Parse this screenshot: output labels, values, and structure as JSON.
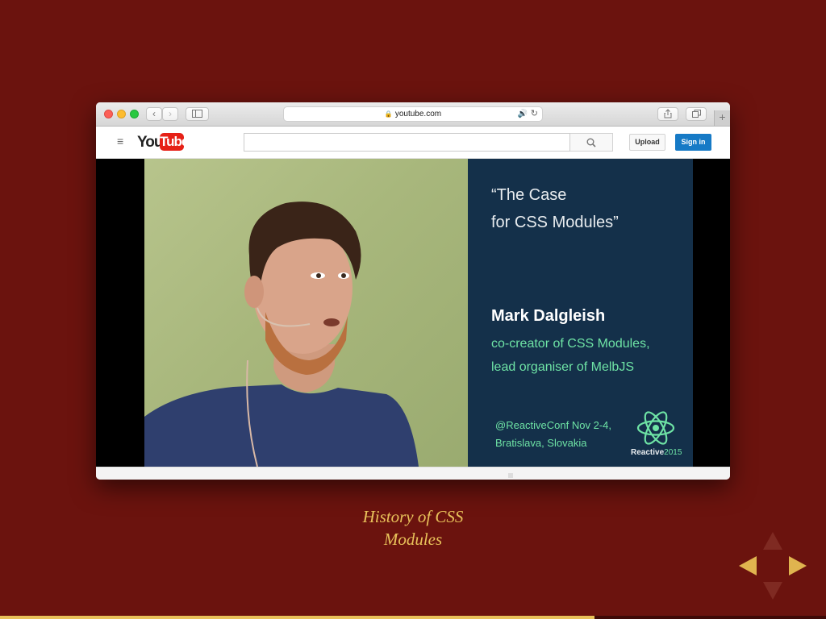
{
  "browser": {
    "url": "youtube.com",
    "new_tab_label": "+"
  },
  "youtube": {
    "logo_you": "You",
    "logo_tube": "Tube",
    "search_placeholder": "",
    "upload_label": "Upload",
    "signin_label": "Sign in"
  },
  "video_slide": {
    "title_line1": "“The Case",
    "title_line2": "for CSS Modules”",
    "speaker_name": "Mark Dalgleish",
    "role_line1": "co-creator of CSS Modules,",
    "role_line2": "lead organiser of MelbJS",
    "conference_line1": "@ReactiveConf Nov 2-4,",
    "conference_line2": "Bratislava, Slovakia",
    "logo_text": "Reactive",
    "logo_year": "2015"
  },
  "presentation": {
    "caption_line1": "History of CSS",
    "caption_line2": "Modules",
    "progress": 0.72
  },
  "colors": {
    "background": "#6b130e",
    "accent": "#e8c15a",
    "slide_bg": "#14304a",
    "slide_green": "#6ee3a5",
    "youtube_red": "#e62117",
    "signin_blue": "#167ac6"
  }
}
